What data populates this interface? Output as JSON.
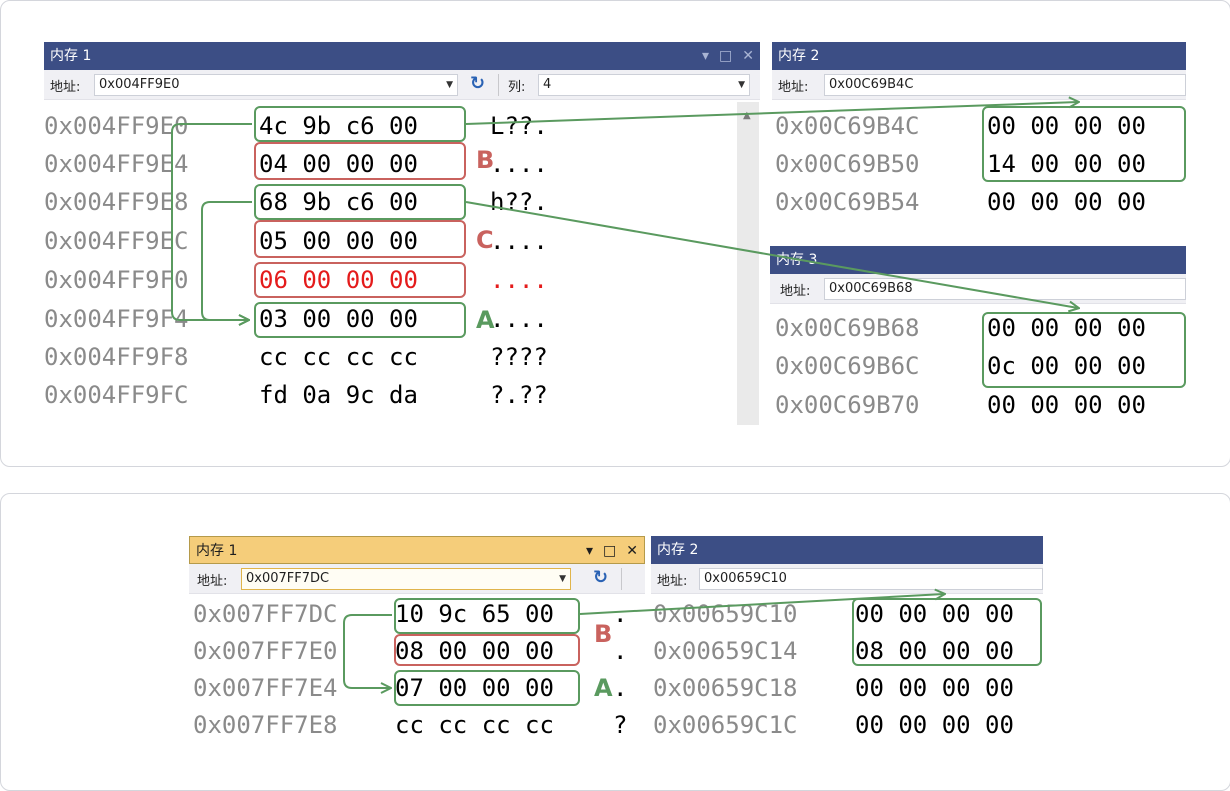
{
  "top": {
    "mem1": {
      "title": "内存 1",
      "controls": [
        "▾",
        "□",
        "✕"
      ],
      "address_label": "地址:",
      "address_value": "0x004FF9E0",
      "columns_label": "列:",
      "columns_value": "4",
      "rows": [
        {
          "addr": "0x004FF9E0",
          "bytes": "4c 9b c6 00",
          "ascii": "L??."
        },
        {
          "addr": "0x004FF9E4",
          "bytes": "04 00 00 00",
          "ascii": "...."
        },
        {
          "addr": "0x004FF9E8",
          "bytes": "68 9b c6 00",
          "ascii": "h??."
        },
        {
          "addr": "0x004FF9EC",
          "bytes": "05 00 00 00",
          "ascii": "...."
        },
        {
          "addr": "0x004FF9F0",
          "bytes": "06 00 00 00",
          "ascii": "...."
        },
        {
          "addr": "0x004FF9F4",
          "bytes": "03 00 00 00",
          "ascii": "...."
        },
        {
          "addr": "0x004FF9F8",
          "bytes": "cc cc cc cc",
          "ascii": "????"
        },
        {
          "addr": "0x004FF9FC",
          "bytes": "fd 0a 9c da",
          "ascii": "?.??"
        }
      ]
    },
    "mem2": {
      "title": "内存 2",
      "address_label": "地址:",
      "address_value": "0x00C69B4C",
      "rows": [
        {
          "addr": "0x00C69B4C",
          "bytes": "00 00 00 00"
        },
        {
          "addr": "0x00C69B50",
          "bytes": "14 00 00 00"
        },
        {
          "addr": "0x00C69B54",
          "bytes": "00 00 00 00"
        }
      ]
    },
    "mem3": {
      "title": "内存 3",
      "address_label": "地址:",
      "address_value": "0x00C69B68",
      "rows": [
        {
          "addr": "0x00C69B68",
          "bytes": "00 00 00 00"
        },
        {
          "addr": "0x00C69B6C",
          "bytes": "0c 00 00 00"
        },
        {
          "addr": "0x00C69B70",
          "bytes": "00 00 00 00"
        }
      ]
    },
    "labels": {
      "a": "A",
      "b": "B",
      "c": "C"
    }
  },
  "bottom": {
    "mem1": {
      "title": "内存 1",
      "controls": [
        "▾",
        "□",
        "✕"
      ],
      "address_label": "地址:",
      "address_value": "0x007FF7DC",
      "rows": [
        {
          "addr": "0x007FF7DC",
          "bytes": "10 9c 65 00",
          "ascii": "."
        },
        {
          "addr": "0x007FF7E0",
          "bytes": "08 00 00 00",
          "ascii": "."
        },
        {
          "addr": "0x007FF7E4",
          "bytes": "07 00 00 00",
          "ascii": "."
        },
        {
          "addr": "0x007FF7E8",
          "bytes": "cc cc cc cc",
          "ascii": "?"
        }
      ]
    },
    "mem2": {
      "title": "内存 2",
      "address_label": "地址:",
      "address_value": "0x00659C10",
      "rows": [
        {
          "addr": "0x00659C10",
          "bytes": "00 00 00 00"
        },
        {
          "addr": "0x00659C14",
          "bytes": "08 00 00 00"
        },
        {
          "addr": "0x00659C18",
          "bytes": "00 00 00 00"
        },
        {
          "addr": "0x00659C1C",
          "bytes": "00 00 00 00"
        }
      ]
    },
    "labels": {
      "a": "A",
      "b": "B"
    }
  },
  "colors": {
    "title_bar": "#3c4e85",
    "title_bar_active": "#f5cd7a",
    "annotation_green": "#5a9a5f",
    "annotation_red": "#c9625e",
    "changed_value": "#e41b1b",
    "address_text": "#8a8a8a"
  }
}
